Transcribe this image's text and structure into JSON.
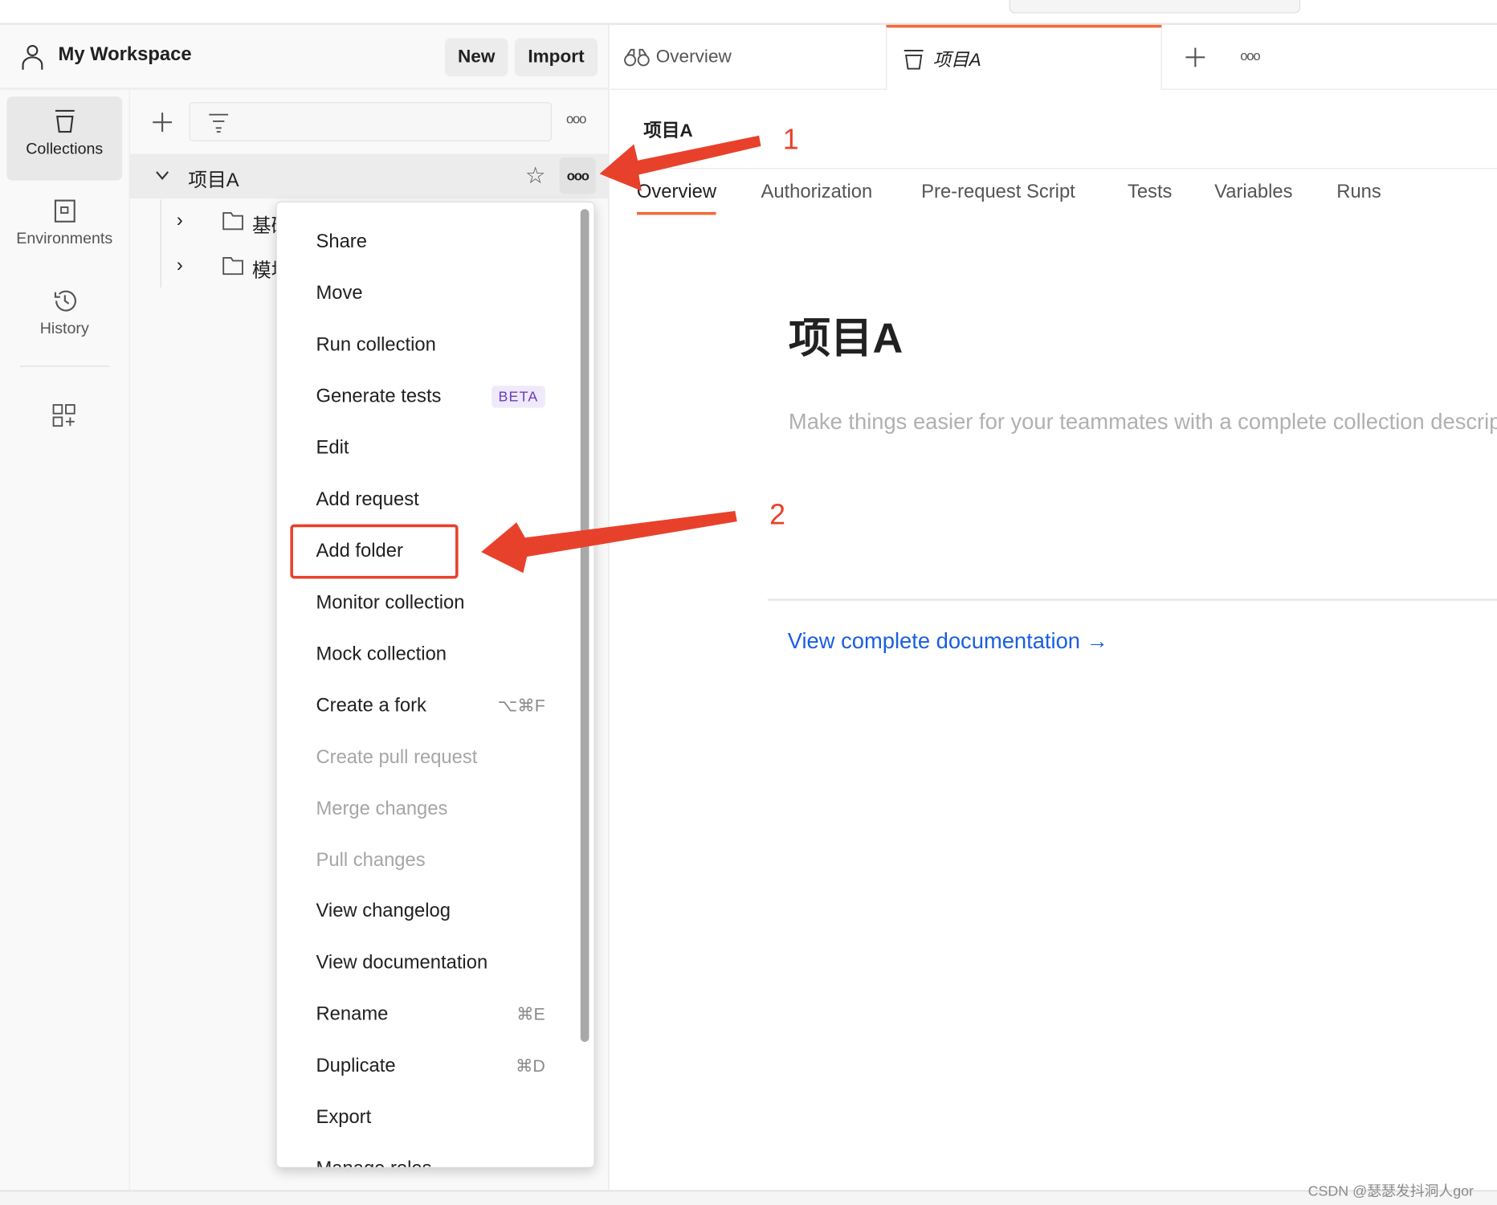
{
  "workspace": {
    "title": "My Workspace",
    "new_label": "New",
    "import_label": "Import"
  },
  "nav": {
    "items": [
      {
        "label": "Collections",
        "icon": "collection-icon",
        "active": true
      },
      {
        "label": "Environments",
        "icon": "environment-icon"
      },
      {
        "label": "History",
        "icon": "history-icon"
      }
    ],
    "configure_icon": "add-widget-icon"
  },
  "tree": {
    "collection": "项目A",
    "folders": [
      "基础",
      "模块"
    ]
  },
  "menu": {
    "items": [
      {
        "label": "Share"
      },
      {
        "label": "Move"
      },
      {
        "label": "Run collection"
      },
      {
        "label": "Generate tests",
        "badge": "BETA"
      },
      {
        "label": "Edit"
      },
      {
        "label": "Add request"
      },
      {
        "label": "Add folder",
        "highlighted": true
      },
      {
        "label": "Monitor collection"
      },
      {
        "label": "Mock collection"
      },
      {
        "label": "Create a fork",
        "shortcut": "⌥⌘F"
      },
      {
        "label": "Create pull request",
        "disabled": true
      },
      {
        "label": "Merge changes",
        "disabled": true
      },
      {
        "label": "Pull changes",
        "disabled": true
      },
      {
        "label": "View changelog"
      },
      {
        "label": "View documentation"
      },
      {
        "label": "Rename",
        "shortcut": "⌘E"
      },
      {
        "label": "Duplicate",
        "shortcut": "⌘D"
      },
      {
        "label": "Export"
      },
      {
        "label": "Manage roles"
      }
    ]
  },
  "tabs": [
    {
      "label": "Overview",
      "icon": "binoculars-icon"
    },
    {
      "label": "项目A",
      "icon": "collection-icon",
      "active": true
    }
  ],
  "main": {
    "breadcrumb": "项目A",
    "subtabs": [
      "Overview",
      "Authorization",
      "Pre-request Script",
      "Tests",
      "Variables",
      "Runs"
    ],
    "active_subtab": "Overview",
    "title": "项目A",
    "description_placeholder": "Make things easier for your teammates with a complete collection description.",
    "docs_link": "View complete documentation →"
  },
  "annotations": {
    "step1": "1",
    "step2": "2",
    "color": "#e8412b"
  },
  "watermark": "CSDN @瑟瑟发抖洞人gor",
  "colors": {
    "accent": "#f26b3a",
    "link": "#1a5ee0"
  }
}
